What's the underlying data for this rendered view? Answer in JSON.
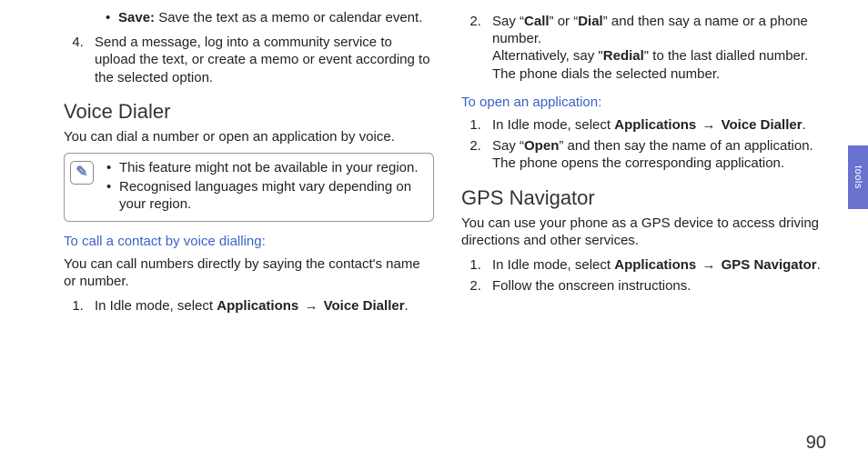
{
  "left": {
    "save_bullet": {
      "label": "Save:",
      "desc": "Save the text as a memo or calendar event."
    },
    "step4": "Send a message, log into a community service to upload the text, or create a memo or event according to the selected option.",
    "voice_dialer_title": "Voice Dialer",
    "voice_dialer_intro": "You can dial a number or open an application by voice.",
    "note_glyph": "✎",
    "note_items": [
      "This feature might not be available in your region.",
      "Recognised languages might vary depending on your region."
    ],
    "call_heading": "To call a contact by voice dialling:",
    "call_intro": "You can call numbers directly by saying the contact's name or number.",
    "call_step1_pre": "In Idle mode, select ",
    "call_step1_b1": "Applications",
    "arrow": "→",
    "call_step1_b2": "Voice Dialler",
    "period": "."
  },
  "right": {
    "step2_a": "Say “",
    "step2_b1": "Call",
    "step2_mid": "” or “",
    "step2_b2": "Dial",
    "step2_c": "” and then say a name or a phone number.",
    "step2_alt_pre": "Alternatively, say \"",
    "step2_alt_b": "Redial",
    "step2_alt_post": "\" to the last dialled number.",
    "step2_result": "The phone dials the selected number.",
    "open_heading": "To open an application:",
    "open_step1_pre": "In Idle mode, select ",
    "open_step1_b1": "Applications",
    "arrow": "→",
    "open_step1_b2": "Voice Dialler",
    "period": ".",
    "open_step2_a": "Say “",
    "open_step2_b": "Open",
    "open_step2_c": "” and then say the name of an application.",
    "open_step2_result": "The phone opens the corresponding application.",
    "gps_title": "GPS Navigator",
    "gps_intro": "You can use your phone as a GPS device to access driving directions and other services.",
    "gps_step1_pre": "In Idle mode, select ",
    "gps_step1_b1": "Applications",
    "gps_step1_b2": "GPS Navigator",
    "gps_step2": "Follow the onscreen instructions."
  },
  "side_tab": "tools",
  "page_number": "90"
}
